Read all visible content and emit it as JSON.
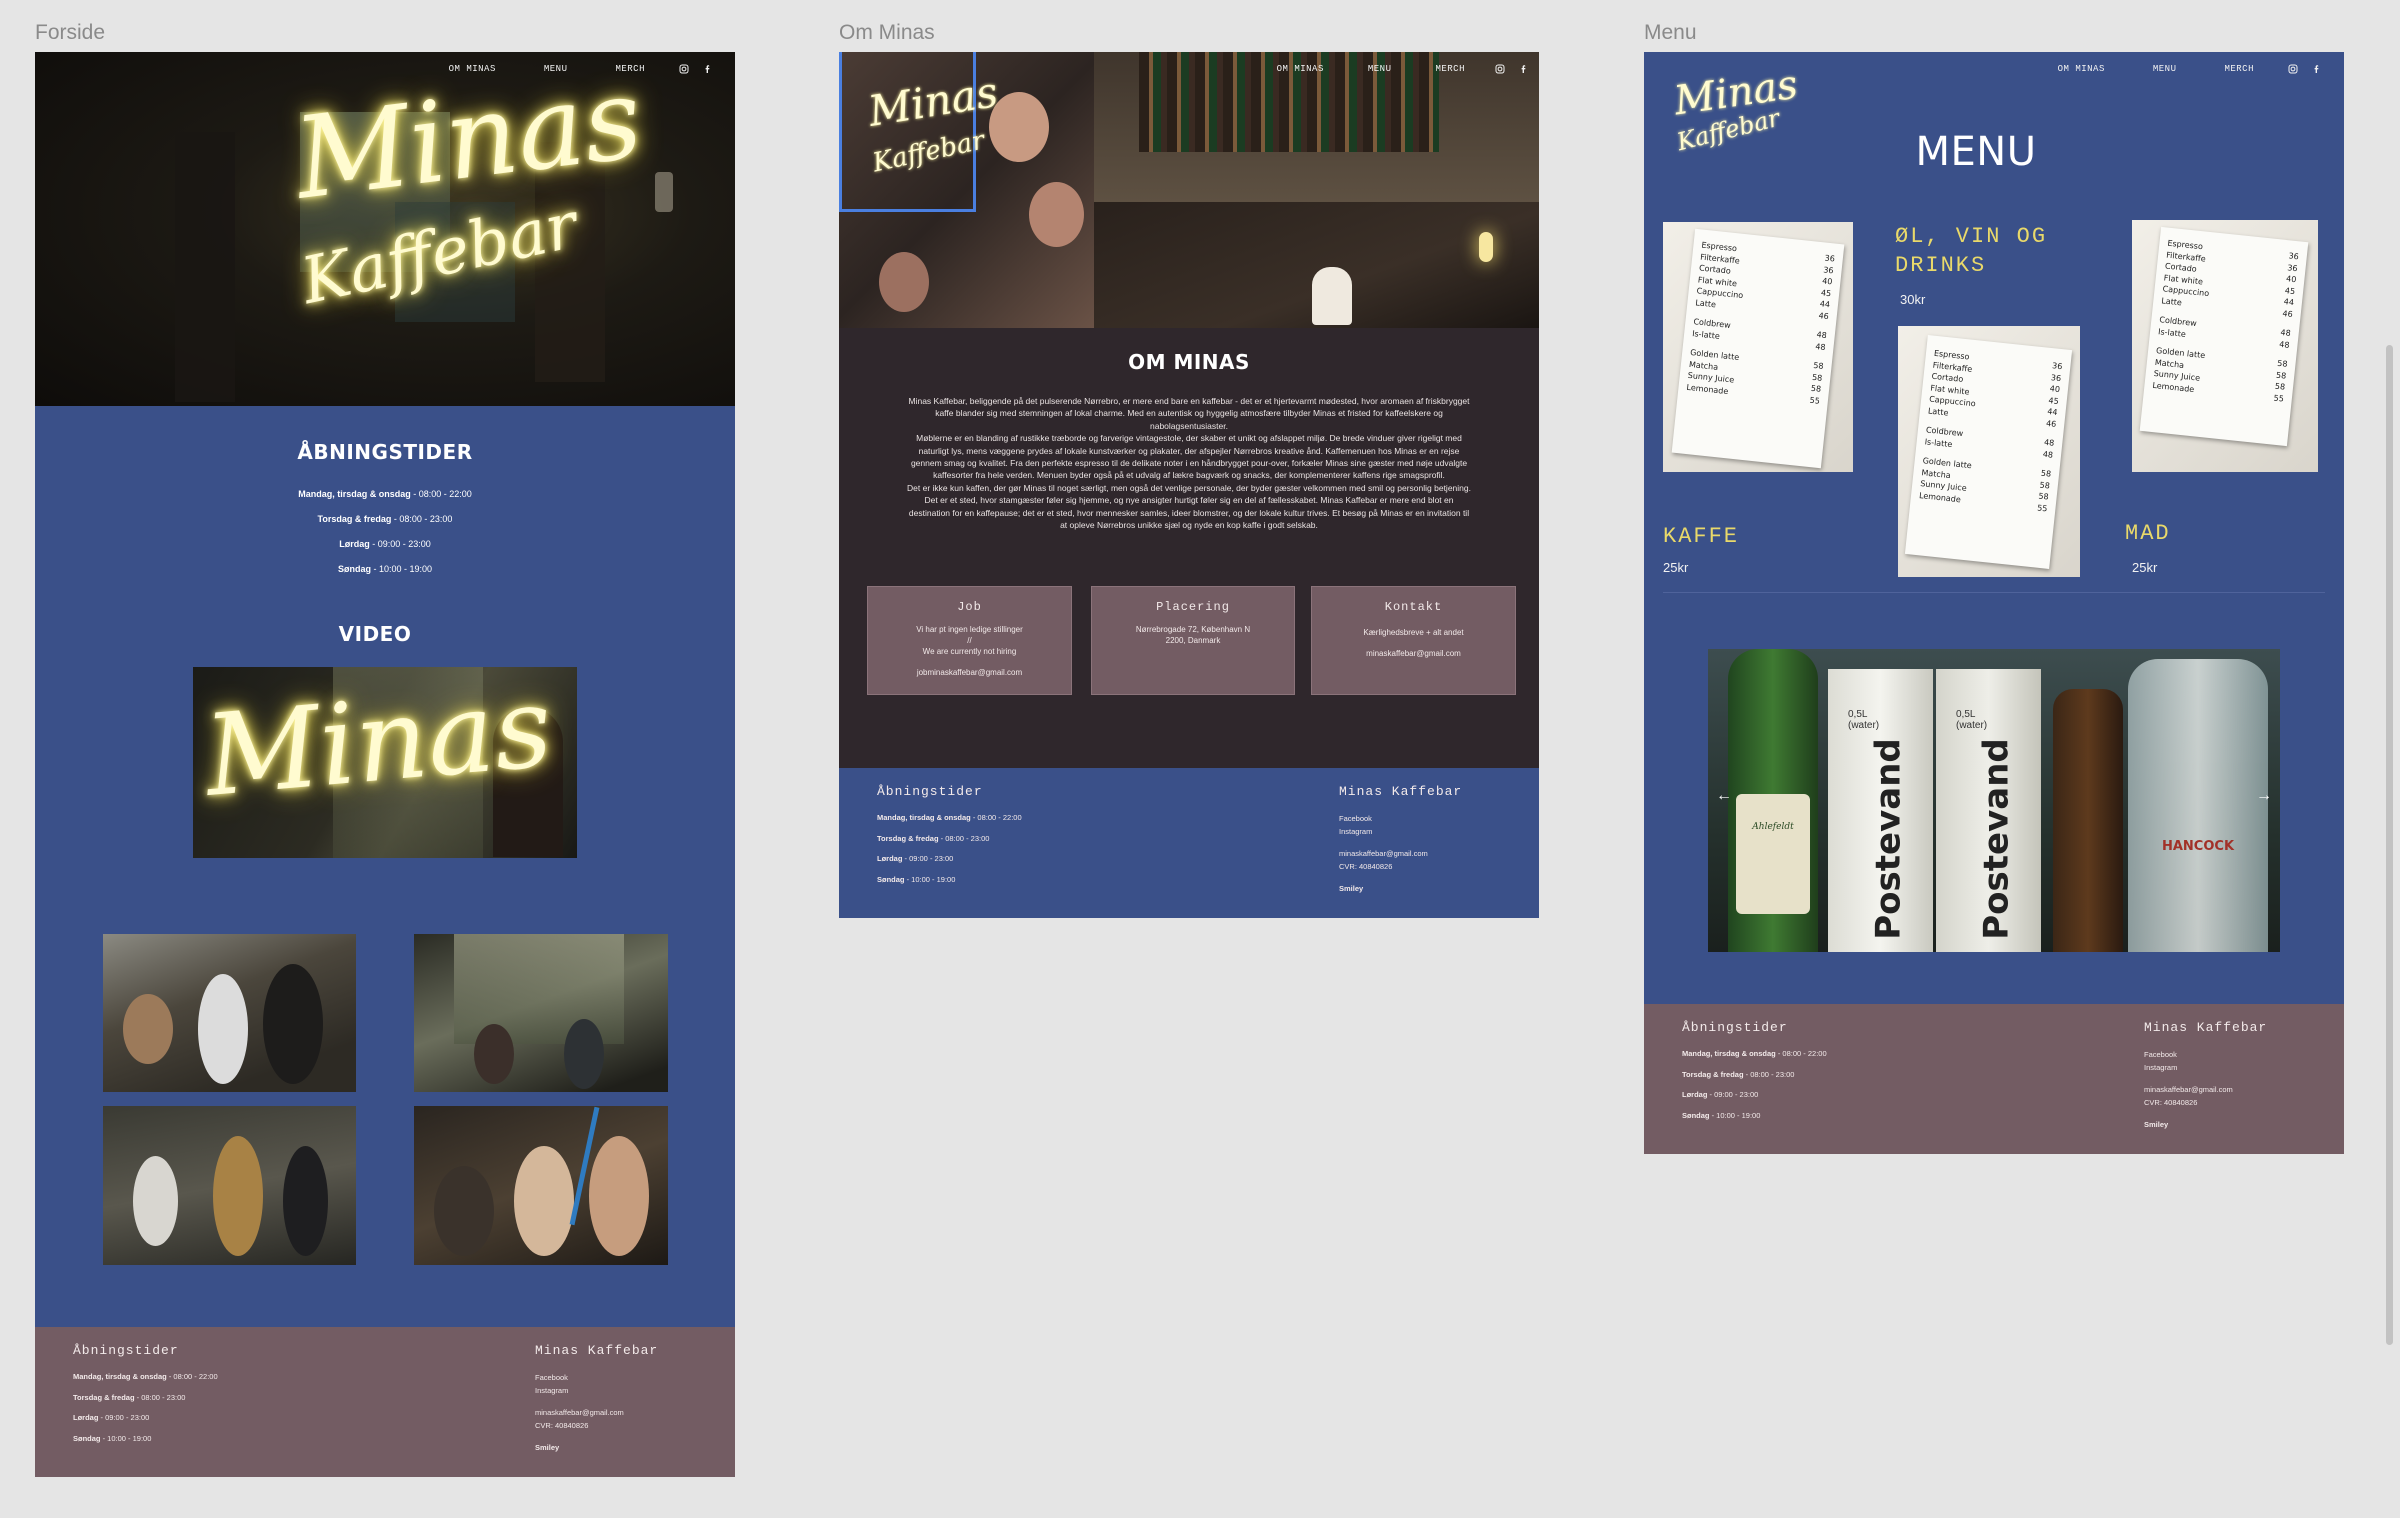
{
  "frames": {
    "forside": {
      "label": "Forside"
    },
    "om_minas": {
      "label": "Om Minas"
    },
    "menu": {
      "label": "Menu"
    }
  },
  "nav": {
    "items": [
      "OM MINAS",
      "MENU",
      "MERCH"
    ],
    "social_icons": [
      "instagram-icon",
      "facebook-icon"
    ]
  },
  "brand": {
    "line1": "Minas",
    "line2": "Kaffebar"
  },
  "forside": {
    "hours_title": "ÅBNINGSTIDER",
    "hours": [
      {
        "day": "Mandag, tirsdag & onsdag",
        "time": " - 08:00 - 22:00"
      },
      {
        "day": "Torsdag & fredag",
        "time": " - 08:00 - 23:00"
      },
      {
        "day": "Lørdag",
        "time": " - 09:00 - 23:00"
      },
      {
        "day": "Søndag",
        "time": " - 10:00 - 19:00"
      }
    ],
    "video_title": "VIDEO",
    "video_neon": "Minas"
  },
  "om_minas": {
    "title": "OM MINAS",
    "paragraphs": [
      "Minas Kaffebar, beliggende på det pulserende Nørrebro, er mere end bare en kaffebar - det er et hjertevarmt mødested, hvor aromaen af friskbrygget kaffe blander sig med stemningen af lokal charme. Med en autentisk og hyggelig atmosfære tilbyder Minas et fristed for kaffeelskere og nabolagsentusiaster.",
      "Møblerne er en blanding af rustikke træborde og farverige vintagestole, der skaber et unikt og afslappet miljø. De brede vinduer giver rigeligt med naturligt lys, mens væggene prydes af lokale kunstværker og plakater, der afspejler Nørrebros kreative ånd. Kaffemenuen hos Minas er en rejse gennem smag og kvalitet. Fra den perfekte espresso til de delikate noter i en håndbrygget pour-over, forkæler Minas sine gæster med nøje udvalgte kaffesorter fra hele verden. Menuen byder også på et udvalg af lækre bagværk og snacks, der komplementerer kaffens rige smagsprofil.",
      "Det er ikke kun kaffen, der gør Minas til noget særligt, men også det venlige personale, der byder gæster velkommen med smil og personlig betjening. Det er et sted, hvor stamgæster føler sig hjemme, og nye ansigter hurtigt føler sig en del af fællesskabet. Minas Kaffebar er mere end blot en destination for en kaffepause; det er et sted, hvor mennesker samles, ideer blomstrer, og der lokale kultur trives. Et besøg på Minas er en invitation til at opleve Nørrebros unikke sjæl og nyde en kop kaffe i godt selskab."
    ],
    "cards": [
      {
        "title": "Job",
        "lines": [
          "Vi har pt ingen ledige stillinger",
          "//",
          "We are currently not hiring",
          "",
          "jobminaskaffebar@gmail.com"
        ]
      },
      {
        "title": "Placering",
        "lines": [
          "Nørrebrogade 72, København N",
          "2200, Danmark"
        ]
      },
      {
        "title": "Kontakt",
        "lines": [
          "Kærlighedsbreve + alt andet",
          "",
          "minaskaffebar@gmail.com"
        ]
      }
    ]
  },
  "menu_page": {
    "title": "MENU",
    "drinks_title_1": "ØL, VIN OG",
    "drinks_title_2": "DRINKS",
    "drinks_price": "30kr",
    "coffee_title": "KAFFE",
    "coffee_price": "25kr",
    "food_title": "MAD",
    "food_price": "25kr",
    "board_items": [
      {
        "name": "Espresso",
        "price": "36"
      },
      {
        "name": "Filterkaffe",
        "price": "36"
      },
      {
        "name": "Cortado",
        "price": "40"
      },
      {
        "name": "Flat white",
        "price": "45"
      },
      {
        "name": "Cappuccino",
        "price": "44"
      },
      {
        "name": "Latte",
        "price": "46"
      },
      {
        "name": "Coldbrew",
        "price": "48"
      },
      {
        "name": "Is-latte",
        "price": "48"
      },
      {
        "name": "Golden latte",
        "price": "58"
      },
      {
        "name": "Matcha",
        "price": "58"
      },
      {
        "name": "Sunny Juice",
        "price": "58"
      },
      {
        "name": "Lemonade",
        "price": "55"
      }
    ],
    "carousel_prev": "←",
    "carousel_next": "→",
    "bottle_labels": [
      "Postevand",
      "Postevand"
    ],
    "bottle_small": [
      "0,5L",
      "(water)"
    ],
    "bottle_brand": [
      "Ahlefeldt",
      "HANCOCK"
    ]
  },
  "footer": {
    "hours_title": "Åbningstider",
    "brand_title": "Minas Kaffebar",
    "hours": [
      {
        "day": "Mandag, tirsdag & onsdag",
        "time": " - 08:00 - 22:00"
      },
      {
        "day": "Torsdag & fredag",
        "time": " - 08:00 - 23:00"
      },
      {
        "day": "Lørdag",
        "time": " - 09:00 - 23:00"
      },
      {
        "day": "Søndag",
        "time": " - 10:00 - 19:00"
      }
    ],
    "links": [
      "Facebook",
      "Instagram"
    ],
    "email": "minaskaffebar@gmail.com",
    "cvr": "CVR: 40840826",
    "smiley": "Smiley"
  },
  "colors": {
    "blue": "#3a5089",
    "mauve": "#735c63",
    "dark": "#2f272c",
    "neon": "#fffbd0",
    "gold": "#e9d96a"
  }
}
